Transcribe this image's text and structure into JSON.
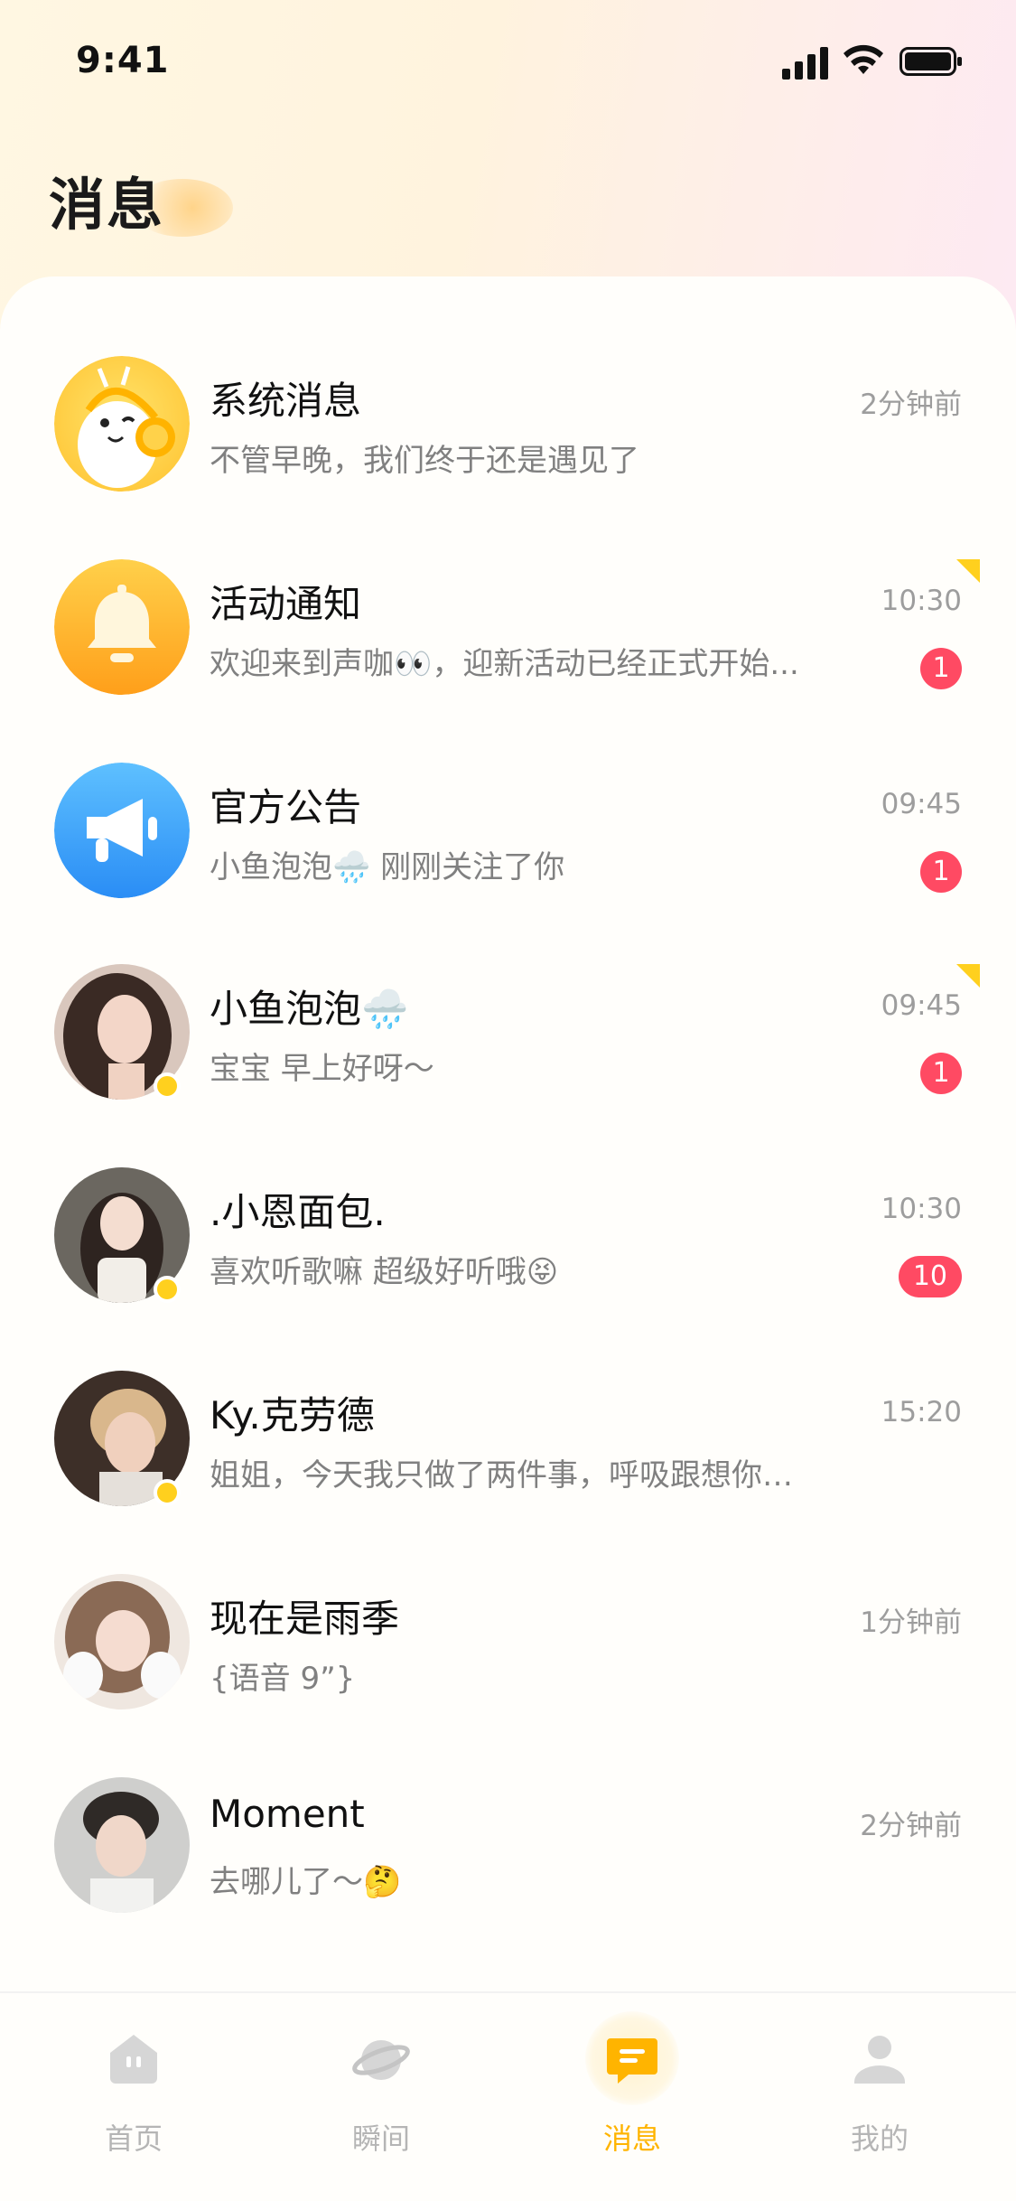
{
  "status_bar": {
    "time": "9:41"
  },
  "header": {
    "title": "消息"
  },
  "conversations": [
    {
      "name": "系统消息",
      "preview": "不管早晚，我们终于还是遇见了",
      "time": "2分钟前",
      "badge": "",
      "online": false,
      "flag": false,
      "avatar": "mascot-avatar"
    },
    {
      "name": "活动通知",
      "preview": "欢迎来到声咖👀，迎新活动已经正式开始...",
      "time": "10:30",
      "badge": "1",
      "online": false,
      "flag": true,
      "avatar": "bell-icon"
    },
    {
      "name": "官方公告",
      "preview": "小鱼泡泡🌧️ 刚刚关注了你",
      "time": "09:45",
      "badge": "1",
      "online": false,
      "flag": false,
      "avatar": "megaphone-icon"
    },
    {
      "name": "小鱼泡泡🌧️",
      "preview": "宝宝 早上好呀～",
      "time": "09:45",
      "badge": "1",
      "online": true,
      "flag": true,
      "avatar": "user-photo"
    },
    {
      "name": ".小恩面包.",
      "preview": "喜欢听歌嘛 超级好听哦😝",
      "time": "10:30",
      "badge": "10",
      "online": true,
      "flag": false,
      "avatar": "user-photo"
    },
    {
      "name": "Ky.克劳德",
      "preview": "姐姐，今天我只做了两件事，呼吸跟想你…",
      "time": "15:20",
      "badge": "",
      "online": true,
      "flag": false,
      "avatar": "user-photo"
    },
    {
      "name": "现在是雨季",
      "preview": "{语音 9”}",
      "time": "1分钟前",
      "badge": "",
      "online": false,
      "flag": false,
      "avatar": "user-photo"
    },
    {
      "name": "Moment",
      "preview": "去哪儿了～🤔",
      "time": "2分钟前",
      "badge": "",
      "online": false,
      "flag": false,
      "avatar": "user-photo"
    }
  ],
  "tabbar": {
    "items": [
      {
        "label": "首页",
        "icon": "home-icon",
        "active": false
      },
      {
        "label": "瞬间",
        "icon": "planet-icon",
        "active": false
      },
      {
        "label": "消息",
        "icon": "message-icon",
        "active": true
      },
      {
        "label": "我的",
        "icon": "profile-icon",
        "active": false
      }
    ]
  },
  "colors": {
    "accent": "#ffb400",
    "badge": "#ff4a63",
    "online": "#ffd01e"
  }
}
